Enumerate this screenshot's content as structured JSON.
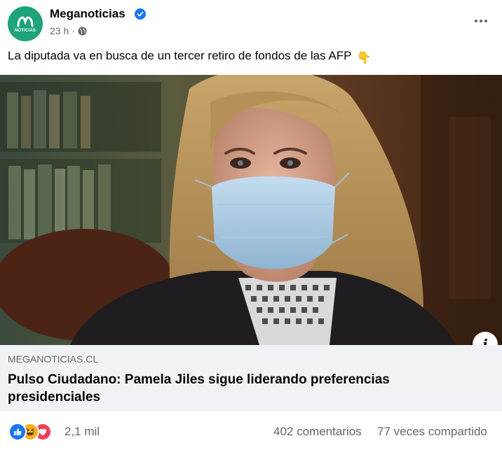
{
  "post": {
    "page_name": "Meganoticias",
    "avatar_label": "NOTICIAS",
    "time": "23 h",
    "separator": "·",
    "privacy_icon": "globe-icon",
    "verified_icon": "verified-badge-icon",
    "message": "La diputada va en busca de un tercer retiro de fondos de las AFP",
    "message_emoji": "👇"
  },
  "link": {
    "domain": "MEGANOTICIAS.CL",
    "title": "Pulso Ciudadano: Pamela Jiles sigue liderando preferencias presidenciales",
    "info_label": "i"
  },
  "footer": {
    "reaction_count": "2,1 mil",
    "comments": "402 comentarios",
    "shares": "77 veces compartido",
    "reaction_icons": [
      "like-icon",
      "haha-icon",
      "love-icon"
    ]
  },
  "colors": {
    "brand": "#1ea37a",
    "verified": "#1877f2",
    "secondary_text": "#65676b",
    "card_bg": "#f0f2f5"
  }
}
